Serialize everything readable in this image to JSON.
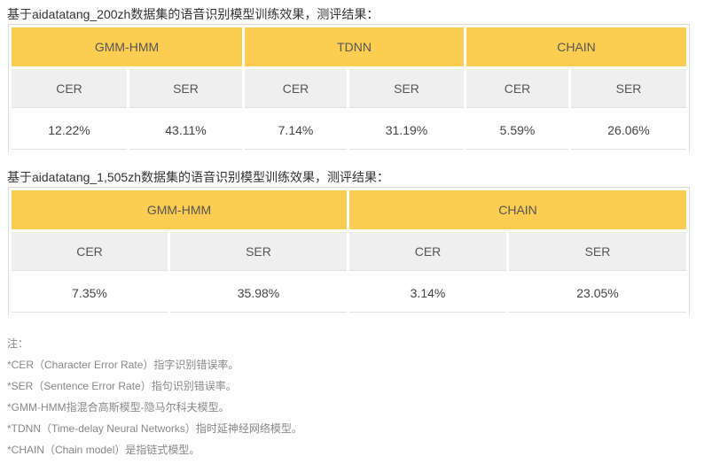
{
  "section1": {
    "caption": "基于aidatatang_200zh数据集的语音识别模型训练效果，测评结果：",
    "models": [
      "GMM-HMM",
      "TDNN",
      "CHAIN"
    ],
    "metrics": [
      "CER",
      "SER",
      "CER",
      "SER",
      "CER",
      "SER"
    ],
    "values": [
      "12.22%",
      "43.11%",
      "7.14%",
      "31.19%",
      "5.59%",
      "26.06%"
    ]
  },
  "section2": {
    "caption": "基于aidatatang_1,505zh数据集的语音识别模型训练效果，测评结果：",
    "models": [
      "GMM-HMM",
      "CHAIN"
    ],
    "metrics": [
      "CER",
      "SER",
      "CER",
      "SER"
    ],
    "values": [
      "7.35%",
      "35.98%",
      "3.14%",
      "23.05%"
    ]
  },
  "notes": {
    "title": "注：",
    "items": [
      "*CER（Character Error Rate）指字识别错误率。",
      "*SER（Sentence Error Rate）指句识别错误率。",
      "*GMM-HMM指混合高斯模型-隐马尔科夫模型。",
      "*TDNN（Time-delay Neural Networks）指时延神经网络模型。",
      "*CHAIN（Chain model）是指链式模型。"
    ]
  },
  "colors": {
    "header_bg": "#fdcd52",
    "subheader_bg": "#efefef",
    "border": "#dcdcdc"
  }
}
